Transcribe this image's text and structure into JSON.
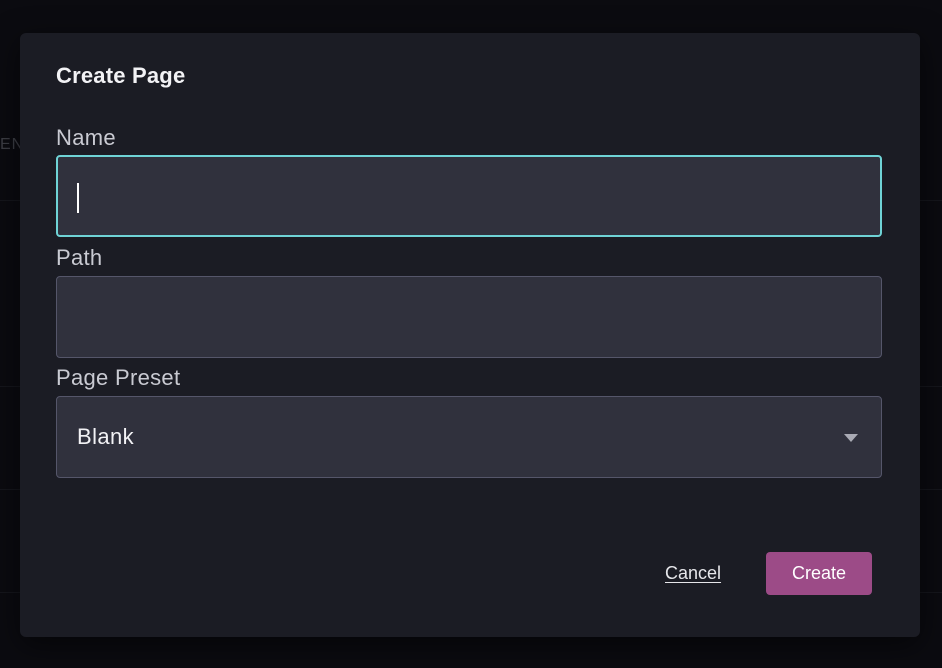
{
  "background": {
    "partial_text": "EN"
  },
  "dialog": {
    "title": "Create Page",
    "fields": {
      "name": {
        "label": "Name",
        "value": "",
        "focused": true
      },
      "path": {
        "label": "Path",
        "value": ""
      },
      "page_preset": {
        "label": "Page Preset",
        "selected": "Blank"
      }
    },
    "actions": {
      "cancel_label": "Cancel",
      "create_label": "Create"
    }
  },
  "colors": {
    "focus_border": "#6fd3d6",
    "primary_button": "#9c4b87",
    "dialog_bg": "#1b1c24",
    "input_bg": "#30313d"
  },
  "icons": {
    "select_arrow": "chevron-down-icon"
  }
}
